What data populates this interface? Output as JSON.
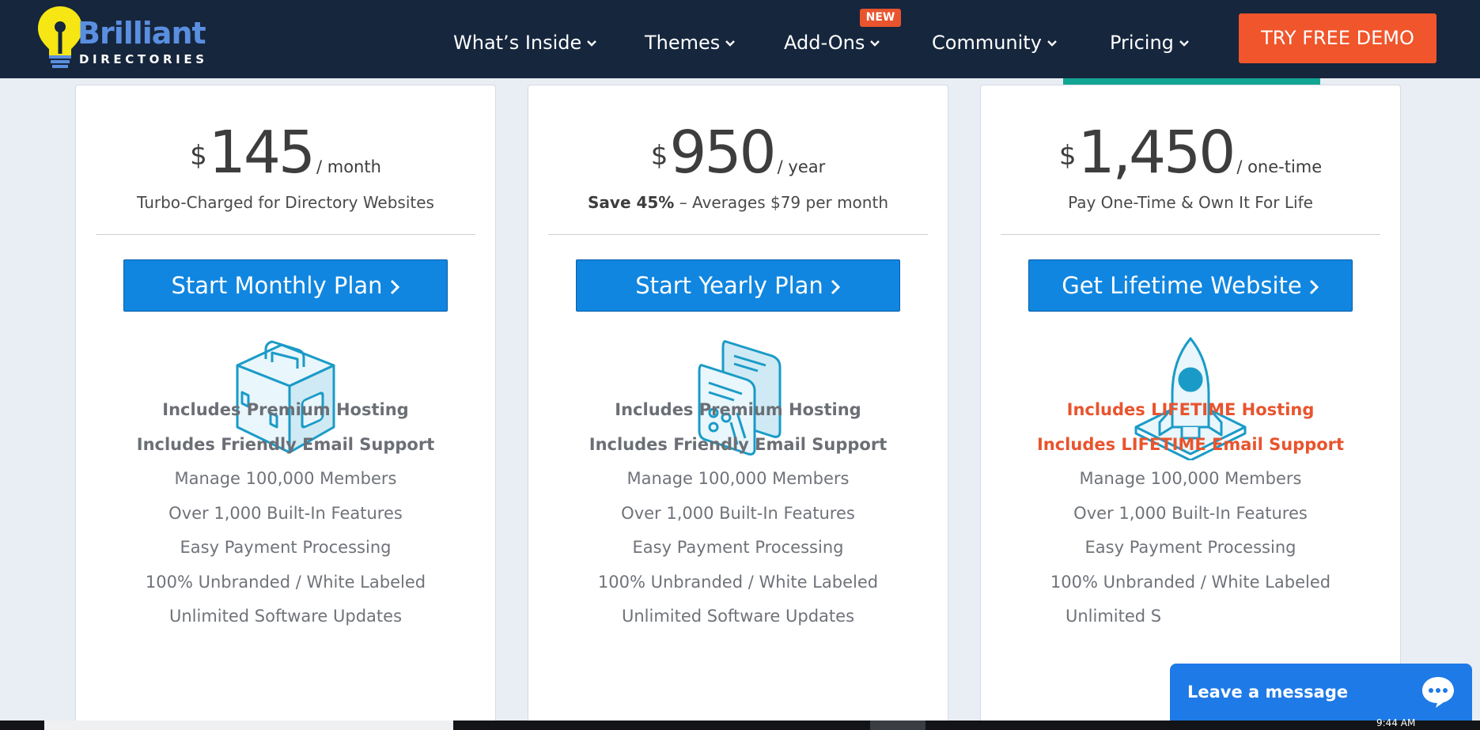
{
  "nav": {
    "logo": {
      "word": "Brilliant",
      "sub": "DIRECTORIES"
    },
    "items": [
      {
        "label": "What’s Inside"
      },
      {
        "label": "Themes"
      },
      {
        "label": "Add-Ons"
      },
      {
        "label": "Community"
      },
      {
        "label": "Pricing"
      }
    ],
    "new_badge": "NEW",
    "demo_button": "TRY FREE DEMO"
  },
  "plans": [
    {
      "currency": "$",
      "amount": "145",
      "period": "/ month",
      "subtitle_bold": "",
      "subtitle": "Turbo-Charged for Directory Websites",
      "button": "Start Monthly Plan",
      "illustration": "toolbox-icon",
      "features_highlight": [
        "Includes Premium Hosting",
        "Includes Friendly Email Support"
      ],
      "features": [
        "Manage 100,000 Members",
        "Over 1,000 Built-In Features",
        "Easy Payment Processing",
        "100% Unbranded / White Labeled",
        "Unlimited Software Updates"
      ]
    },
    {
      "currency": "$",
      "amount": "950",
      "period": "/ year",
      "subtitle_bold": "Save 45%",
      "subtitle": " – Averages $79 per month",
      "button": "Start Yearly Plan",
      "illustration": "server-tools-icon",
      "features_highlight": [
        "Includes Premium Hosting",
        "Includes Friendly Email Support"
      ],
      "features": [
        "Manage 100,000 Members",
        "Over 1,000 Built-In Features",
        "Easy Payment Processing",
        "100% Unbranded / White Labeled",
        "Unlimited Software Updates"
      ]
    },
    {
      "currency": "$",
      "amount": "1,450",
      "period": "/ one-time",
      "subtitle_bold": "",
      "subtitle": "Pay One-Time & Own It For Life",
      "button": "Get Lifetime Website",
      "illustration": "rocket-icon",
      "features_highlight": [
        "Includes LIFETIME Hosting",
        "Includes LIFETIME Email Support"
      ],
      "features": [
        "Manage 100,000 Members",
        "Over 1,000 Built-In Features",
        "Easy Payment Processing",
        "100% Unbranded / White Labeled",
        "Unlimited S"
      ]
    }
  ],
  "chat": {
    "label": "Leave a message"
  },
  "taskbar": {
    "time": "9:44 AM"
  },
  "colors": {
    "nav_bg": "#16263d",
    "demo_orange": "#f0552b",
    "button_blue": "#1086e0",
    "accent_teal": "#13a594",
    "lifetime_orange": "#e8542e",
    "chat_blue": "#1e7ae6"
  }
}
